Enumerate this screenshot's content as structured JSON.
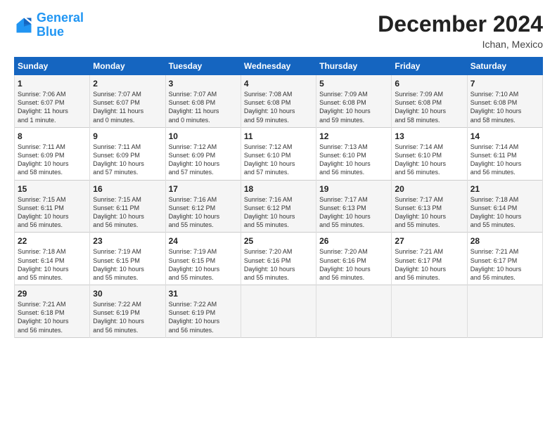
{
  "logo": {
    "line1": "General",
    "line2": "Blue"
  },
  "title": "December 2024",
  "location": "Ichan, Mexico",
  "headers": [
    "Sunday",
    "Monday",
    "Tuesday",
    "Wednesday",
    "Thursday",
    "Friday",
    "Saturday"
  ],
  "weeks": [
    [
      {
        "day": "1",
        "info": "Sunrise: 7:06 AM\nSunset: 6:07 PM\nDaylight: 11 hours\nand 1 minute."
      },
      {
        "day": "2",
        "info": "Sunrise: 7:07 AM\nSunset: 6:07 PM\nDaylight: 11 hours\nand 0 minutes."
      },
      {
        "day": "3",
        "info": "Sunrise: 7:07 AM\nSunset: 6:08 PM\nDaylight: 11 hours\nand 0 minutes."
      },
      {
        "day": "4",
        "info": "Sunrise: 7:08 AM\nSunset: 6:08 PM\nDaylight: 10 hours\nand 59 minutes."
      },
      {
        "day": "5",
        "info": "Sunrise: 7:09 AM\nSunset: 6:08 PM\nDaylight: 10 hours\nand 59 minutes."
      },
      {
        "day": "6",
        "info": "Sunrise: 7:09 AM\nSunset: 6:08 PM\nDaylight: 10 hours\nand 58 minutes."
      },
      {
        "day": "7",
        "info": "Sunrise: 7:10 AM\nSunset: 6:08 PM\nDaylight: 10 hours\nand 58 minutes."
      }
    ],
    [
      {
        "day": "8",
        "info": "Sunrise: 7:11 AM\nSunset: 6:09 PM\nDaylight: 10 hours\nand 58 minutes."
      },
      {
        "day": "9",
        "info": "Sunrise: 7:11 AM\nSunset: 6:09 PM\nDaylight: 10 hours\nand 57 minutes."
      },
      {
        "day": "10",
        "info": "Sunrise: 7:12 AM\nSunset: 6:09 PM\nDaylight: 10 hours\nand 57 minutes."
      },
      {
        "day": "11",
        "info": "Sunrise: 7:12 AM\nSunset: 6:10 PM\nDaylight: 10 hours\nand 57 minutes."
      },
      {
        "day": "12",
        "info": "Sunrise: 7:13 AM\nSunset: 6:10 PM\nDaylight: 10 hours\nand 56 minutes."
      },
      {
        "day": "13",
        "info": "Sunrise: 7:14 AM\nSunset: 6:10 PM\nDaylight: 10 hours\nand 56 minutes."
      },
      {
        "day": "14",
        "info": "Sunrise: 7:14 AM\nSunset: 6:11 PM\nDaylight: 10 hours\nand 56 minutes."
      }
    ],
    [
      {
        "day": "15",
        "info": "Sunrise: 7:15 AM\nSunset: 6:11 PM\nDaylight: 10 hours\nand 56 minutes."
      },
      {
        "day": "16",
        "info": "Sunrise: 7:15 AM\nSunset: 6:11 PM\nDaylight: 10 hours\nand 56 minutes."
      },
      {
        "day": "17",
        "info": "Sunrise: 7:16 AM\nSunset: 6:12 PM\nDaylight: 10 hours\nand 55 minutes."
      },
      {
        "day": "18",
        "info": "Sunrise: 7:16 AM\nSunset: 6:12 PM\nDaylight: 10 hours\nand 55 minutes."
      },
      {
        "day": "19",
        "info": "Sunrise: 7:17 AM\nSunset: 6:13 PM\nDaylight: 10 hours\nand 55 minutes."
      },
      {
        "day": "20",
        "info": "Sunrise: 7:17 AM\nSunset: 6:13 PM\nDaylight: 10 hours\nand 55 minutes."
      },
      {
        "day": "21",
        "info": "Sunrise: 7:18 AM\nSunset: 6:14 PM\nDaylight: 10 hours\nand 55 minutes."
      }
    ],
    [
      {
        "day": "22",
        "info": "Sunrise: 7:18 AM\nSunset: 6:14 PM\nDaylight: 10 hours\nand 55 minutes."
      },
      {
        "day": "23",
        "info": "Sunrise: 7:19 AM\nSunset: 6:15 PM\nDaylight: 10 hours\nand 55 minutes."
      },
      {
        "day": "24",
        "info": "Sunrise: 7:19 AM\nSunset: 6:15 PM\nDaylight: 10 hours\nand 55 minutes."
      },
      {
        "day": "25",
        "info": "Sunrise: 7:20 AM\nSunset: 6:16 PM\nDaylight: 10 hours\nand 55 minutes."
      },
      {
        "day": "26",
        "info": "Sunrise: 7:20 AM\nSunset: 6:16 PM\nDaylight: 10 hours\nand 56 minutes."
      },
      {
        "day": "27",
        "info": "Sunrise: 7:21 AM\nSunset: 6:17 PM\nDaylight: 10 hours\nand 56 minutes."
      },
      {
        "day": "28",
        "info": "Sunrise: 7:21 AM\nSunset: 6:17 PM\nDaylight: 10 hours\nand 56 minutes."
      }
    ],
    [
      {
        "day": "29",
        "info": "Sunrise: 7:21 AM\nSunset: 6:18 PM\nDaylight: 10 hours\nand 56 minutes."
      },
      {
        "day": "30",
        "info": "Sunrise: 7:22 AM\nSunset: 6:19 PM\nDaylight: 10 hours\nand 56 minutes."
      },
      {
        "day": "31",
        "info": "Sunrise: 7:22 AM\nSunset: 6:19 PM\nDaylight: 10 hours\nand 56 minutes."
      },
      {
        "day": "",
        "info": ""
      },
      {
        "day": "",
        "info": ""
      },
      {
        "day": "",
        "info": ""
      },
      {
        "day": "",
        "info": ""
      }
    ]
  ]
}
